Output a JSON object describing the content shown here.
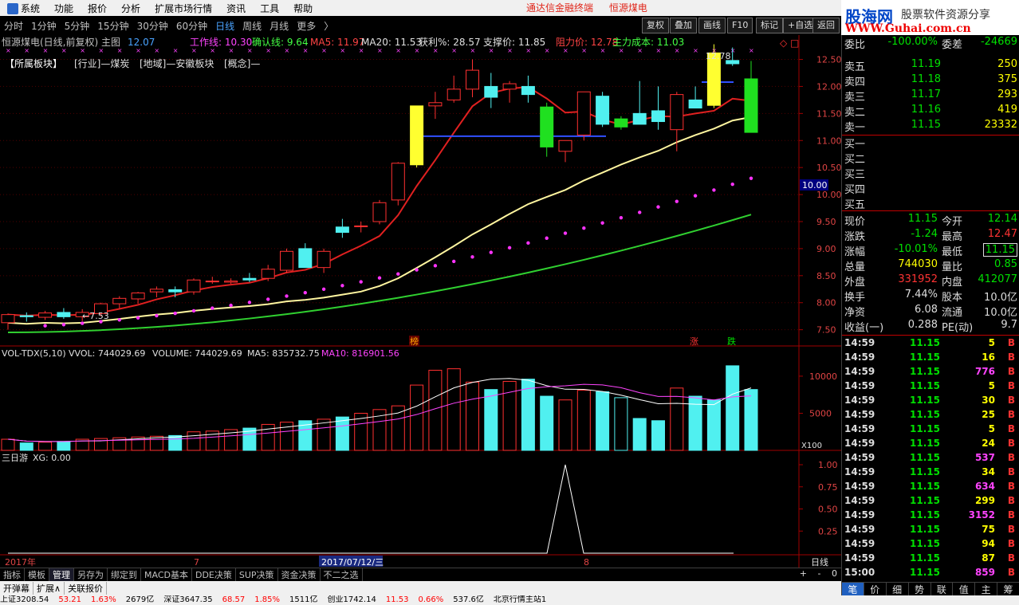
{
  "menubar": {
    "items": [
      "系统",
      "功能",
      "报价",
      "分析",
      "扩展市场行情",
      "资讯",
      "工具",
      "帮助"
    ],
    "center": [
      "通达信金融终端",
      "恒源煤电"
    ]
  },
  "toolbar": {
    "periods": [
      "分时",
      "1分钟",
      "5分钟",
      "15分钟",
      "30分钟",
      "60分钟",
      "日线",
      "周线",
      "月线",
      "更多",
      "〉"
    ],
    "active": "日线",
    "buttons": [
      "复权",
      "叠加",
      "画线",
      "F10",
      "标记",
      "+自选",
      "返回"
    ]
  },
  "logo": {
    "main": "股海网",
    "sub": "股票软件资源分享",
    "url": "WWW.Guhai.com.cn"
  },
  "chart": {
    "title": "恒源煤电(日线,前复权) 主图",
    "title_value": "12.07",
    "indicators": [
      {
        "label": "工作线: 10.30",
        "color": "#ff44ff"
      },
      {
        "label": "确认线: 9.64",
        "color": "#44ff44"
      },
      {
        "label": "MA5: 11.97",
        "color": "#ff4444"
      },
      {
        "label": "MA20: 11.53",
        "color": "#e0e0e0"
      },
      {
        "label": "获利%: 28.57",
        "color": "#e0e0e0"
      },
      {
        "label": "支撑价: 11.85",
        "color": "#e0e0e0"
      },
      {
        "label": "阻力价: 12.78",
        "color": "#ff4444"
      },
      {
        "label": "主力成本: 11.03",
        "color": "#44ff44"
      }
    ],
    "sector": "【所属板块】",
    "industry": "[行业]—煤炭",
    "region": "[地域]—安徽板块",
    "concept": "[概念]—",
    "price_axis": [
      "12.50",
      "12.00",
      "11.50",
      "11.00",
      "10.50",
      "10.00",
      "9.50",
      "9.00",
      "8.50",
      "8.00",
      "7.50"
    ],
    "current_price_tag": "10.00",
    "low_label": "←7.53",
    "high_label": "12.78",
    "marker_bang": "榜",
    "marker_zhang": "涨",
    "marker_die": "跌",
    "vol_title": "VOL-TDX(5,10)",
    "vol_values": [
      {
        "label": "VVOL: 744029.69",
        "color": "#e0e0e0"
      },
      {
        "label": "VOLUME: 744029.69",
        "color": "#e0e0e0"
      },
      {
        "label": "MA5: 835732.75",
        "color": "#e0e0e0"
      },
      {
        "label": "MA10: 816901.56",
        "color": "#ff44ff"
      }
    ],
    "vol_axis": [
      "10000",
      "5000"
    ],
    "vol_unit": "X100",
    "ind_title": "三日游",
    "ind_value": "XG: 0.00",
    "ind_axis": [
      "1.00",
      "0.75",
      "0.50",
      "0.25"
    ],
    "date_labels": [
      "2017年",
      "7",
      "2017/07/12/三",
      "8"
    ],
    "period_label": "日线"
  },
  "chart_data": {
    "type": "candlestick",
    "candles": [
      {
        "o": 7.63,
        "h": 7.8,
        "l": 7.5,
        "c": 7.78
      },
      {
        "o": 7.76,
        "h": 7.82,
        "l": 7.65,
        "c": 7.74
      },
      {
        "o": 7.73,
        "h": 7.85,
        "l": 7.68,
        "c": 7.81
      },
      {
        "o": 7.82,
        "h": 7.9,
        "l": 7.7,
        "c": 7.74
      },
      {
        "o": 7.74,
        "h": 7.88,
        "l": 7.66,
        "c": 7.82
      },
      {
        "o": 7.8,
        "h": 8.0,
        "l": 7.75,
        "c": 7.98
      },
      {
        "o": 7.98,
        "h": 8.12,
        "l": 7.9,
        "c": 8.08
      },
      {
        "o": 8.07,
        "h": 8.2,
        "l": 7.98,
        "c": 8.18
      },
      {
        "o": 8.2,
        "h": 8.3,
        "l": 8.1,
        "c": 8.25
      },
      {
        "o": 8.24,
        "h": 8.3,
        "l": 8.1,
        "c": 8.2
      },
      {
        "o": 8.2,
        "h": 8.45,
        "l": 8.15,
        "c": 8.42
      },
      {
        "o": 8.4,
        "h": 8.48,
        "l": 8.35,
        "c": 8.4
      },
      {
        "o": 8.38,
        "h": 8.45,
        "l": 8.35,
        "c": 8.4
      },
      {
        "o": 8.45,
        "h": 8.55,
        "l": 8.38,
        "c": 8.42
      },
      {
        "o": 8.45,
        "h": 8.7,
        "l": 8.4,
        "c": 8.62
      },
      {
        "o": 8.6,
        "h": 9.0,
        "l": 8.55,
        "c": 8.95
      },
      {
        "o": 9.0,
        "h": 9.1,
        "l": 8.72,
        "c": 8.65
      },
      {
        "o": 8.65,
        "h": 9.0,
        "l": 8.55,
        "c": 8.95
      },
      {
        "o": 9.4,
        "h": 9.55,
        "l": 9.2,
        "c": 9.3
      },
      {
        "o": 9.42,
        "h": 9.5,
        "l": 9.3,
        "c": 9.42
      },
      {
        "o": 9.5,
        "h": 9.9,
        "l": 9.45,
        "c": 9.85
      },
      {
        "o": 9.9,
        "h": 10.6,
        "l": 9.8,
        "c": 10.58
      },
      {
        "o": 10.55,
        "h": 11.64,
        "l": 10.5,
        "c": 11.64
      },
      {
        "o": 11.64,
        "h": 11.9,
        "l": 11.4,
        "c": 11.7
      },
      {
        "o": 11.75,
        "h": 12.2,
        "l": 11.7,
        "c": 11.95
      },
      {
        "o": 11.95,
        "h": 12.5,
        "l": 11.8,
        "c": 12.3
      },
      {
        "o": 12.0,
        "h": 12.25,
        "l": 11.6,
        "c": 11.8
      },
      {
        "o": 11.95,
        "h": 12.1,
        "l": 11.7,
        "c": 12.05
      },
      {
        "o": 12.0,
        "h": 12.2,
        "l": 11.7,
        "c": 11.85
      },
      {
        "o": 11.62,
        "h": 11.7,
        "l": 10.7,
        "c": 10.88
      },
      {
        "o": 10.8,
        "h": 11.0,
        "l": 10.6,
        "c": 11.0
      },
      {
        "o": 11.1,
        "h": 11.9,
        "l": 11.0,
        "c": 11.9
      },
      {
        "o": 11.82,
        "h": 11.9,
        "l": 11.25,
        "c": 11.3
      },
      {
        "o": 11.25,
        "h": 11.45,
        "l": 11.2,
        "c": 11.4
      },
      {
        "o": 11.5,
        "h": 12.1,
        "l": 11.3,
        "c": 11.3
      },
      {
        "o": 11.55,
        "h": 12.0,
        "l": 11.2,
        "c": 11.35
      },
      {
        "o": 11.2,
        "h": 11.9,
        "l": 10.8,
        "c": 11.85
      },
      {
        "o": 11.75,
        "h": 12.0,
        "l": 11.6,
        "c": 11.6
      },
      {
        "o": 12.62,
        "h": 12.78,
        "l": 11.6,
        "c": 11.65
      },
      {
        "o": 12.48,
        "h": 12.72,
        "l": 12.38,
        "c": 12.42
      },
      {
        "o": 12.14,
        "h": 12.47,
        "l": 11.15,
        "c": 11.15
      }
    ],
    "volume": [
      1.5,
      1.0,
      1.1,
      1.2,
      1.5,
      1.6,
      1.7,
      1.8,
      1.9,
      2.0,
      2.5,
      2.6,
      2.8,
      3.0,
      3.5,
      3.8,
      4.0,
      4.2,
      4.5,
      5.0,
      5.5,
      6.0,
      8.8,
      10.8,
      11.0,
      9.2,
      8.2,
      9.3,
      9.6,
      7.3,
      6.8,
      8.1,
      7.9,
      7.1,
      4.3,
      4.0,
      8.4,
      7.3,
      6.8,
      11.4,
      8.2,
      7.4
    ]
  },
  "orderbook": {
    "header_left": "委比",
    "header_left_val": "-100.00%",
    "header_right": "委差",
    "header_right_val": "-24669",
    "sell": [
      {
        "label": "卖五",
        "price": "11.19",
        "vol": "250"
      },
      {
        "label": "卖四",
        "price": "11.18",
        "vol": "375"
      },
      {
        "label": "卖三",
        "price": "11.17",
        "vol": "293"
      },
      {
        "label": "卖二",
        "price": "11.16",
        "vol": "419"
      },
      {
        "label": "卖一",
        "price": "11.15",
        "vol": "23332"
      }
    ],
    "buy": [
      "买一",
      "买二",
      "买三",
      "买四",
      "买五"
    ]
  },
  "quote": [
    {
      "l1": "现价",
      "v1": "11.15",
      "c1": "#00e000",
      "l2": "今开",
      "v2": "12.14",
      "c2": "#00e000"
    },
    {
      "l1": "涨跌",
      "v1": "-1.24",
      "c1": "#00e000",
      "l2": "最高",
      "v2": "12.47",
      "c2": "#ff3333"
    },
    {
      "l1": "涨幅",
      "v1": "-10.01%",
      "c1": "#00e000",
      "l2": "最低",
      "v2": "11.15",
      "c2": "#00e000"
    },
    {
      "l1": "总量",
      "v1": "744030",
      "c1": "#ffff00",
      "l2": "量比",
      "v2": "0.85",
      "c2": "#00e000"
    },
    {
      "l1": "外盘",
      "v1": "331952",
      "c1": "#ff3333",
      "l2": "内盘",
      "v2": "412077",
      "c2": "#00e000"
    },
    {
      "l1": "换手",
      "v1": "7.44%",
      "c1": "#ddd",
      "l2": "股本",
      "v2": "10.0亿",
      "c2": "#ddd"
    },
    {
      "l1": "净资",
      "v1": "6.08",
      "c1": "#ddd",
      "l2": "流通",
      "v2": "10.0亿",
      "c2": "#ddd"
    },
    {
      "l1": "收益(一)",
      "v1": "0.288",
      "c1": "#ddd",
      "l2": "PE(动)",
      "v2": "9.7",
      "c2": "#ddd"
    }
  ],
  "ticks": [
    {
      "t": "14:59",
      "p": "11.15",
      "n": "5",
      "nc": "#ffff00",
      "f": "B"
    },
    {
      "t": "14:59",
      "p": "11.15",
      "n": "16",
      "nc": "#ffff00",
      "f": "B"
    },
    {
      "t": "14:59",
      "p": "11.15",
      "n": "776",
      "nc": "#ff44ff",
      "f": "B"
    },
    {
      "t": "14:59",
      "p": "11.15",
      "n": "5",
      "nc": "#ffff00",
      "f": "B"
    },
    {
      "t": "14:59",
      "p": "11.15",
      "n": "30",
      "nc": "#ffff00",
      "f": "B"
    },
    {
      "t": "14:59",
      "p": "11.15",
      "n": "25",
      "nc": "#ffff00",
      "f": "B"
    },
    {
      "t": "14:59",
      "p": "11.15",
      "n": "5",
      "nc": "#ffff00",
      "f": "B"
    },
    {
      "t": "14:59",
      "p": "11.15",
      "n": "24",
      "nc": "#ffff00",
      "f": "B"
    },
    {
      "t": "14:59",
      "p": "11.15",
      "n": "537",
      "nc": "#ff44ff",
      "f": "B"
    },
    {
      "t": "14:59",
      "p": "11.15",
      "n": "34",
      "nc": "#ffff00",
      "f": "B"
    },
    {
      "t": "14:59",
      "p": "11.15",
      "n": "634",
      "nc": "#ff44ff",
      "f": "B"
    },
    {
      "t": "14:59",
      "p": "11.15",
      "n": "299",
      "nc": "#ffff00",
      "f": "B"
    },
    {
      "t": "14:59",
      "p": "11.15",
      "n": "3152",
      "nc": "#ff44ff",
      "f": "B"
    },
    {
      "t": "14:59",
      "p": "11.15",
      "n": "75",
      "nc": "#ffff00",
      "f": "B"
    },
    {
      "t": "14:59",
      "p": "11.15",
      "n": "94",
      "nc": "#ffff00",
      "f": "B"
    },
    {
      "t": "14:59",
      "p": "11.15",
      "n": "87",
      "nc": "#ffff00",
      "f": "B"
    },
    {
      "t": "15:00",
      "p": "11.15",
      "n": "859",
      "nc": "#ff44ff",
      "f": "B"
    }
  ],
  "right_tabs": [
    "笔",
    "价",
    "细",
    "势",
    "联",
    "值",
    "主",
    "筹"
  ],
  "bottom_tabs": [
    "指标",
    "模板",
    "管理",
    "另存为",
    "绑定到",
    "MACD基本",
    "DDE决策",
    "SUP决策",
    "资金决策",
    "不二之选"
  ],
  "bottom_nav": [
    "+",
    "-",
    "0"
  ],
  "extra_tabs": [
    "开弹幕",
    "扩展∧",
    "关联报价"
  ],
  "status": [
    "上证3208.54",
    "53.21",
    "1.63%",
    "2679亿",
    "深证3647.35",
    "68.57",
    "1.85%",
    "1511亿",
    "创业1742.14",
    "11.53",
    "0.66%",
    "537.6亿",
    "北京行情主站1"
  ]
}
